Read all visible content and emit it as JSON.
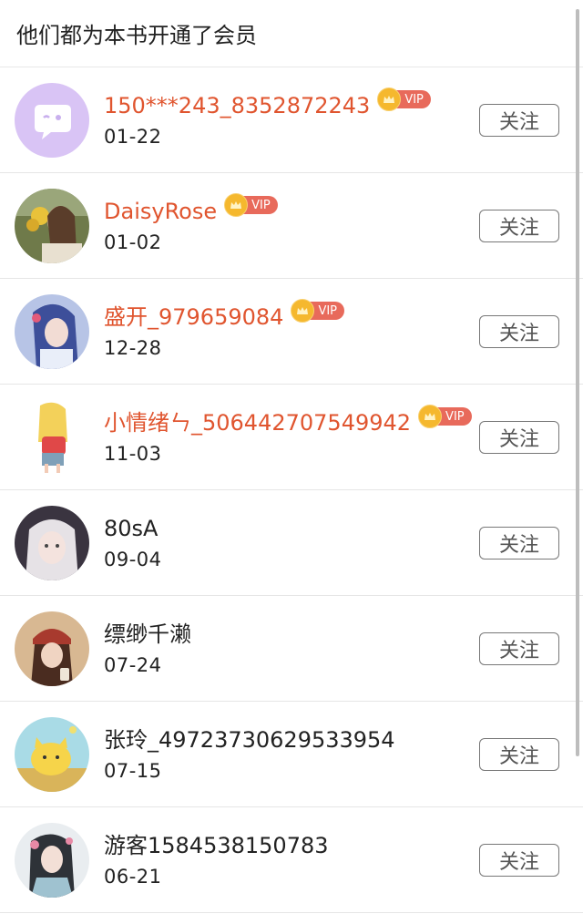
{
  "header": {
    "title": "他们都为本书开通了会员"
  },
  "follow_label": "关注",
  "vip_label": "VIP",
  "members": [
    {
      "name": "150***243_8352872243",
      "date": "01-22",
      "vip": true,
      "avatar": "purple-chat"
    },
    {
      "name": "DaisyRose",
      "date": "01-02",
      "vip": true,
      "avatar": "photo-flowers"
    },
    {
      "name": "盛开_979659084",
      "date": "12-28",
      "vip": true,
      "avatar": "anime-blue"
    },
    {
      "name": "小情绪ㄣ_506442707549942",
      "date": "11-03",
      "vip": true,
      "avatar": "cartoon-girl"
    },
    {
      "name": "80sA",
      "date": "09-04",
      "vip": false,
      "avatar": "photo-girl-gray"
    },
    {
      "name": "缥缈千濑",
      "date": "07-24",
      "vip": false,
      "avatar": "photo-girl-red"
    },
    {
      "name": "张玲_49723730629533954",
      "date": "07-15",
      "vip": false,
      "avatar": "cartoon-cat"
    },
    {
      "name": "游客1584538150783",
      "date": "06-21",
      "vip": false,
      "avatar": "painting-lady"
    }
  ],
  "colors": {
    "vip_name": "#e0552f",
    "vip_badge": "#e86a5b",
    "crown": "#f5b82e"
  }
}
